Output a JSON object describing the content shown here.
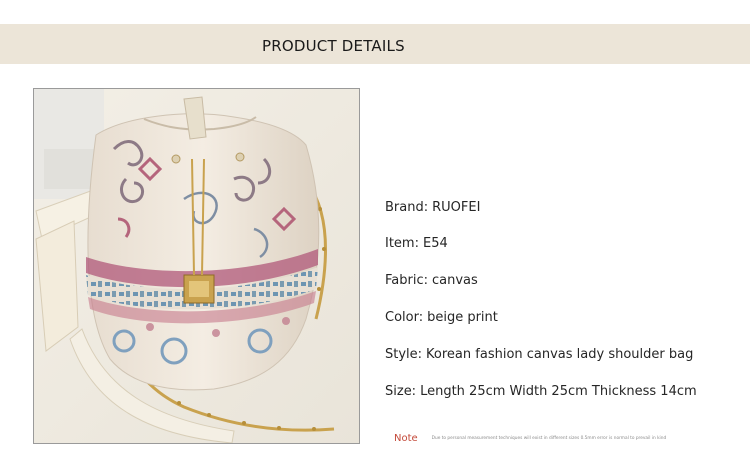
{
  "header": {
    "title": "PRODUCT DETAILS"
  },
  "product_image": {
    "subject": "beige print canvas drawstring bucket shoulder bag with gold chain",
    "icon": "bag-photo"
  },
  "specs": [
    {
      "label": "Brand:",
      "value": "RUOFEI"
    },
    {
      "label": "Item:",
      "value": "E54"
    },
    {
      "label": "Fabric:",
      "value": "canvas"
    },
    {
      "label": "Color:",
      "value": "beige print"
    },
    {
      "label": "Style:",
      "value": "Korean fashion canvas lady shoulder bag"
    },
    {
      "label": "Size:",
      "value": "Length 25cm Width 25cm Thickness 14cm"
    }
  ],
  "note": {
    "label": "Note",
    "text": "Due to personal measurement techniques will exist in different sizes 0.5mm error is normal to prevail in kind"
  },
  "colors": {
    "header_band": "#ece5d8",
    "note_label": "#c44a3a",
    "frame_border": "#9a9a9a"
  }
}
